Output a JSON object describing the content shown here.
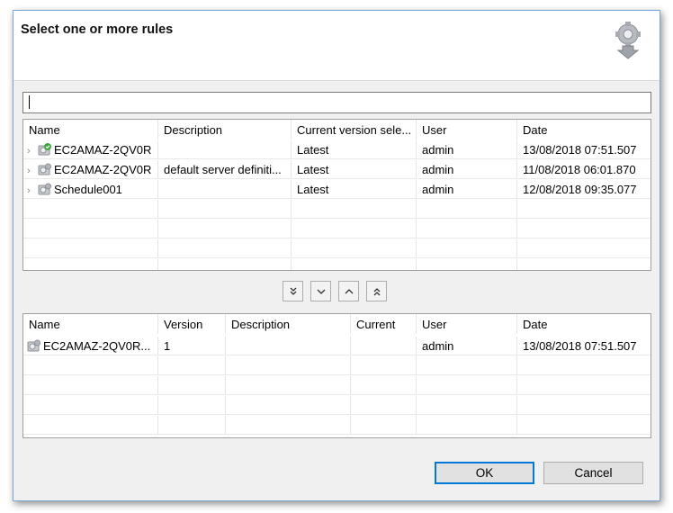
{
  "dialog": {
    "title": "Select one or more rules",
    "header_icon": "gear-download-icon"
  },
  "filter": {
    "value": ""
  },
  "rules_table": {
    "columns": [
      "Name",
      "Description",
      "Current version sele...",
      "User",
      "Date"
    ],
    "rows": [
      {
        "name": "EC2AMAZ-2QV0R",
        "description": "",
        "current_version": "Latest",
        "user": "admin",
        "date": "13/08/2018 07:51.507",
        "icon": "rule-active-icon",
        "twisty": "›"
      },
      {
        "name": "EC2AMAZ-2QV0R",
        "description": "default server definiti...",
        "current_version": "Latest",
        "user": "admin",
        "date": "11/08/2018 06:01.870",
        "icon": "rule-icon",
        "twisty": "›"
      },
      {
        "name": "Schedule001",
        "description": "",
        "current_version": "Latest",
        "user": "admin",
        "date": "12/08/2018 09:35.077",
        "icon": "rule-icon",
        "twisty": "›"
      }
    ]
  },
  "move_buttons": [
    {
      "name": "move-all-down-button",
      "icon": "double-chevron-down-icon"
    },
    {
      "name": "move-down-button",
      "icon": "chevron-down-icon"
    },
    {
      "name": "move-up-button",
      "icon": "chevron-up-icon"
    },
    {
      "name": "move-all-up-button",
      "icon": "double-chevron-up-icon"
    }
  ],
  "selected_table": {
    "columns": [
      "Name",
      "Version",
      "Description",
      "Current",
      "User",
      "Date"
    ],
    "rows": [
      {
        "name": "EC2AMAZ-2QV0R...",
        "version": "1",
        "description": "",
        "current": "",
        "user": "admin",
        "date": "13/08/2018 07:51.507",
        "icon": "rule-icon"
      }
    ]
  },
  "buttons": {
    "ok": "OK",
    "cancel": "Cancel"
  },
  "colors": {
    "accent": "#0078d7",
    "window_border": "#7aa7d6",
    "dialog_bg": "#f0f0f0"
  }
}
